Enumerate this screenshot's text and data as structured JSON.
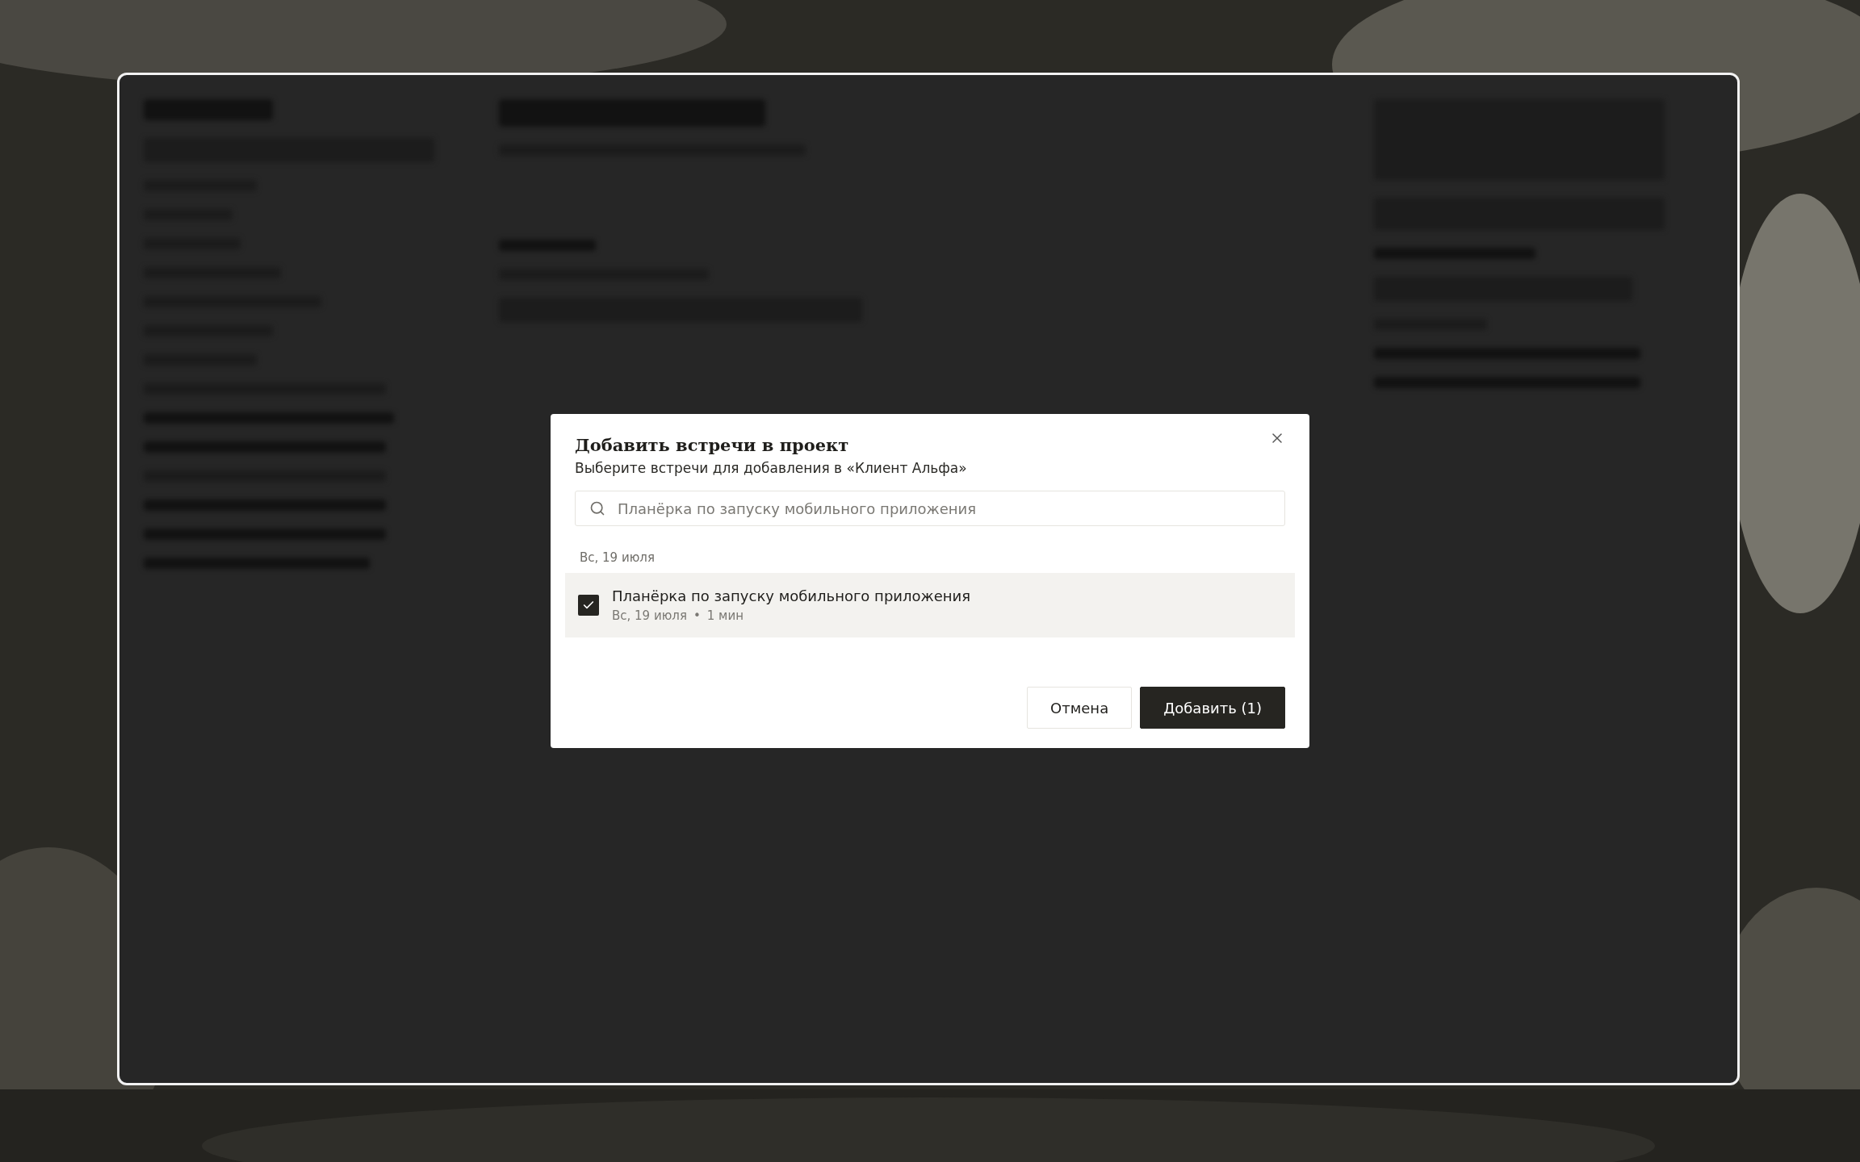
{
  "dialog": {
    "title": "Добавить встречи в проект",
    "subtitle": "Выберите встречи для добавления в «Клиент Альфа»",
    "search": {
      "value": "Планёрка по запуску мобильного приложения"
    },
    "groups": [
      {
        "date": "Вс, 19 июля",
        "meetings": [
          {
            "title": "Планёрка по запуску мобильного приложения",
            "date": "Вс, 19 июля",
            "separator": "•",
            "duration": "1 мин",
            "checked": true
          }
        ]
      }
    ],
    "buttons": [
      {
        "kind": "secondary",
        "label": "Отмена"
      },
      {
        "kind": "primary",
        "label": "Добавить (1)"
      }
    ]
  }
}
